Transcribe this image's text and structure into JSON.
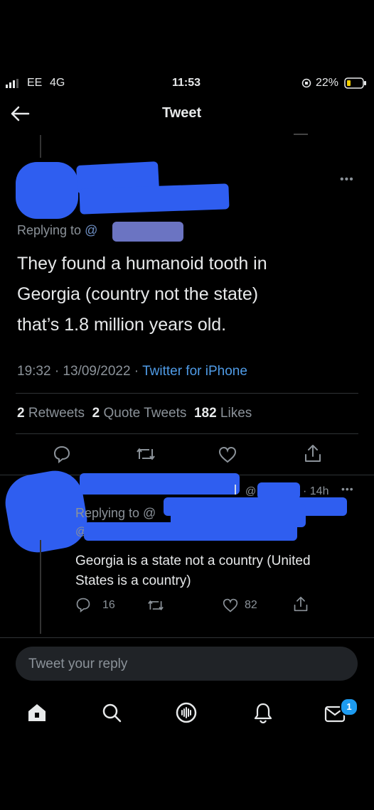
{
  "status_bar": {
    "carrier": "EE",
    "network": "4G",
    "time": "11:53",
    "battery_percent": "22%"
  },
  "header": {
    "title": "Tweet"
  },
  "main_tweet": {
    "replying_prefix": "Replying to",
    "handle_fragment": "@",
    "text_lines": [
      "They found a humanoid tooth in",
      "Georgia (country not the state)",
      "that’s 1.8 million years old."
    ],
    "timestamp": "19:32 · 13/09/2022 · ",
    "source": "Twitter for iPhone",
    "stats": [
      {
        "count": "2",
        "label": "Retweets"
      },
      {
        "count": "2",
        "label": "Quote Tweets"
      },
      {
        "count": "182",
        "label": "Likes"
      }
    ]
  },
  "reply_tweet": {
    "handle_fragment": "@",
    "time": "· 14h",
    "replying_prefix": "Replying to @",
    "mention_fragment": "@",
    "text_lines": [
      "Georgia is a state not a country (United",
      "States is a country)"
    ],
    "reply_count": "16",
    "like_count": "82"
  },
  "reply_box": {
    "placeholder": "Tweet your reply"
  },
  "tab_bar": {
    "messages_badge": "1"
  },
  "colors": {
    "accent": "#1d9bf0",
    "redaction": "#2f5ef0",
    "muted": "#8b9299",
    "background": "#000000"
  }
}
